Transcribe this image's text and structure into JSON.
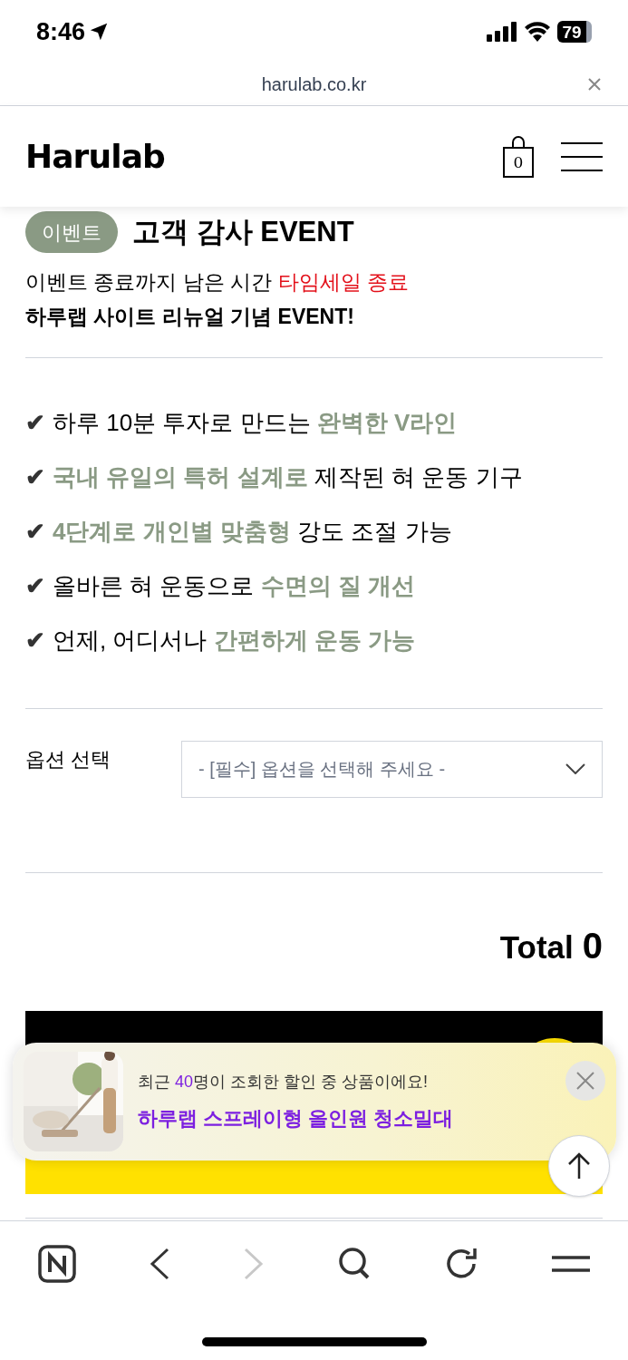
{
  "status_bar": {
    "time": "8:46",
    "battery": "79"
  },
  "address_bar": {
    "url": "harulab.co.kr"
  },
  "header": {
    "logo": "Harulab",
    "cart_count": "0"
  },
  "event": {
    "badge": "이벤트",
    "title": "고객 감사 EVENT",
    "countdown_label": "이벤트 종료까지 남은 시간",
    "countdown_value": "타임세일 종료",
    "subtitle": "하루랩 사이트 리뉴얼 기념 EVENT!"
  },
  "features": [
    {
      "check": "✔",
      "segments": [
        {
          "text": "하루 10분 투자로 만드는 ",
          "highlight": false
        },
        {
          "text": "완벽한 V라인",
          "highlight": true
        }
      ]
    },
    {
      "check": "✔",
      "segments": [
        {
          "text": "국내 유일의 특허 설계로",
          "highlight": true
        },
        {
          "text": " 제작된 혀 운동 기구",
          "highlight": false
        }
      ]
    },
    {
      "check": "✔",
      "segments": [
        {
          "text": "4단계로 개인별 맞춤형",
          "highlight": true
        },
        {
          "text": " 강도 조절 가능",
          "highlight": false
        }
      ]
    },
    {
      "check": "✔",
      "segments": [
        {
          "text": "올바른 혀 운동으로 ",
          "highlight": false
        },
        {
          "text": "수면의 질 개선",
          "highlight": true
        }
      ]
    },
    {
      "check": "✔",
      "segments": [
        {
          "text": "언제, 어디서나 ",
          "highlight": false
        },
        {
          "text": "간편하게 운동 가능",
          "highlight": true
        }
      ]
    }
  ],
  "option": {
    "label": "옵션 선택",
    "placeholder": "- [필수] 옵션을 선택해 주세요 -"
  },
  "total": {
    "label": "Total",
    "value": "0"
  },
  "popup": {
    "message": "최근 **40**명이 조회한 할인 중 상품이에요!",
    "product": "하루랩 스프레이형 올인원 청소밀대"
  },
  "browser_toolbar": {
    "forward_disabled": true
  }
}
